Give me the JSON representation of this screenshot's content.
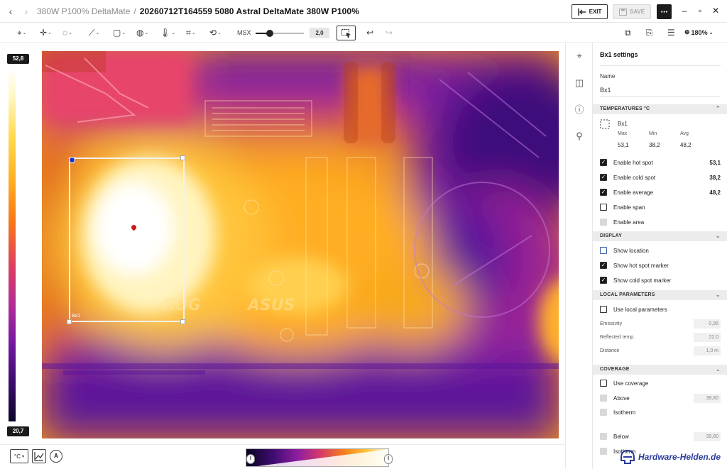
{
  "titlebar": {
    "breadcrumb_parent": "380W P100% DeltaMate",
    "separator": "/",
    "breadcrumb_current": "20260712T164559 5080 Astral DeltaMate 380W P100%",
    "exit_label": "EXIT",
    "save_label": "SAVE",
    "more_label": "···"
  },
  "toolbar": {
    "msx_label": "MSX",
    "msx_value": "2,0",
    "msx_level": 0.3,
    "zoom_label": "180%"
  },
  "scale": {
    "max": "52,8",
    "min": "20,7"
  },
  "image": {
    "box_label": "Bx1"
  },
  "panel": {
    "title": "Bx1 settings",
    "name_label": "Name",
    "name_value": "Bx1",
    "temperatures": {
      "header": "TEMPERATURES °C",
      "measure_name": "Bx1",
      "cols": [
        "Max",
        "Min",
        "Avg"
      ],
      "vals": [
        "53,1",
        "38,2",
        "48,2"
      ]
    },
    "toggles": [
      {
        "label": "Enable hot spot",
        "checked": true,
        "value": "53,1"
      },
      {
        "label": "Enable cold spot",
        "checked": true,
        "value": "38,2"
      },
      {
        "label": "Enable average",
        "checked": true,
        "value": "48,2"
      },
      {
        "label": "Enable span",
        "checked": false,
        "value": ""
      },
      {
        "label": "Enable area",
        "checked": false,
        "value": ""
      }
    ],
    "display": {
      "header": "DISPLAY",
      "items": [
        {
          "label": "Show location",
          "checked": false
        },
        {
          "label": "Show hot spot marker",
          "checked": true
        },
        {
          "label": "Show cold spot marker",
          "checked": true
        }
      ]
    },
    "local_params": {
      "header": "LOCAL PARAMETERS",
      "use_label": "Use local parameters",
      "rows": [
        {
          "label": "Emissivity",
          "value": "0,95"
        },
        {
          "label": "Reflected temp.",
          "value": "22,0"
        },
        {
          "label": "Distance",
          "value": "1,0 m"
        }
      ]
    },
    "coverage": {
      "header": "COVERAGE",
      "use_label": "Use coverage",
      "above_label": "Above",
      "above_value": "39,80",
      "isotherm_label": "Isotherm",
      "below_label": "Below",
      "below_value": "39,80",
      "isotherm2_label": "Isotherm"
    }
  },
  "bottombar": {
    "unit_label": "°C",
    "auto_label": "A"
  },
  "watermark": {
    "text": "Hardware-Helden.de"
  },
  "colors": {
    "accent_dark": "#1a1a1a",
    "hot_marker": "#d01818",
    "anchor_blue": "#1e2fd0",
    "brand": "#2a3a9a"
  }
}
